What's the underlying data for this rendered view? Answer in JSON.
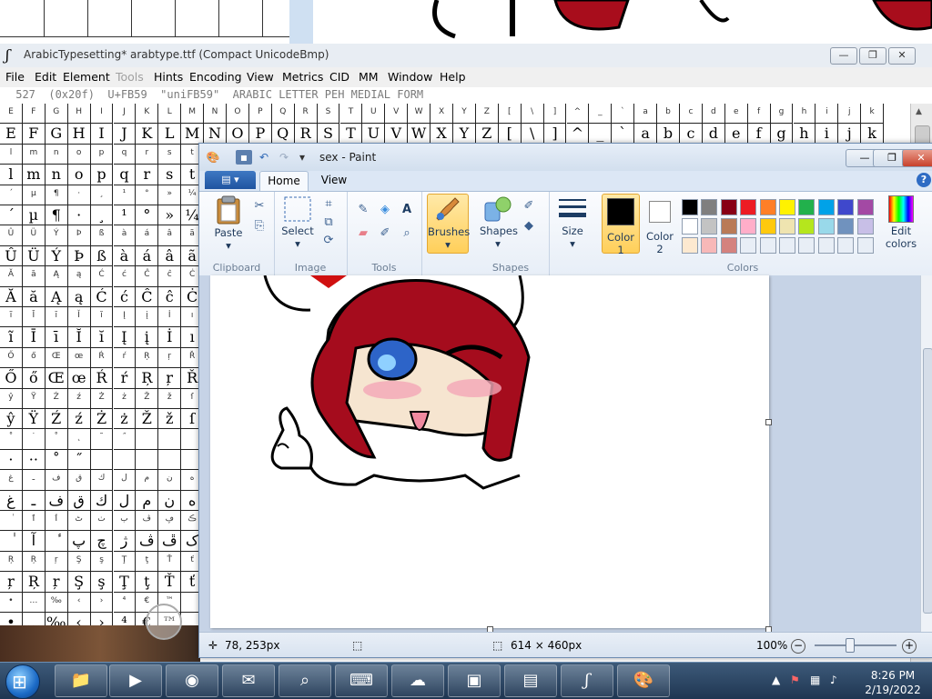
{
  "fontforge": {
    "title": "ArabicTypesetting*  arabtype.ttf (Compact UnicodeBmp)",
    "menu": [
      "File",
      "Edit",
      "Element",
      "Tools",
      "Hints",
      "Encoding",
      "View",
      "Metrics",
      "CID",
      "MM",
      "Window",
      "Help"
    ],
    "disabled_menu": "Tools",
    "info_line": " 527  (0x20f)  U+FB59  \"uniFB59\"  ARABIC LETTER PEH MEDIAL FORM",
    "header_row": [
      "E",
      "F",
      "G",
      "H",
      "I",
      "J",
      "K",
      "L",
      "M",
      "N",
      "O",
      "P",
      "Q",
      "R",
      "S",
      "T",
      "U",
      "V",
      "W",
      "X",
      "Y",
      "Z",
      "[",
      "\\",
      "]",
      "^",
      "_",
      "`",
      "a",
      "b",
      "c",
      "d",
      "e",
      "f",
      "g",
      "h",
      "i",
      "j",
      "k"
    ],
    "glyph_row": [
      "E",
      "F",
      "G",
      "H",
      "I",
      "J",
      "K",
      "L",
      "M",
      "N",
      "O",
      "P",
      "Q",
      "R",
      "S",
      "T",
      "U",
      "V",
      "W",
      "X",
      "Y",
      "Z",
      "[",
      "\\",
      "]",
      "^",
      "_",
      "`",
      "a",
      "b",
      "c",
      "d",
      "e",
      "f",
      "g",
      "h",
      "i",
      "j",
      "k"
    ],
    "left_grid": [
      [
        "l",
        "m",
        "n",
        "o",
        "p",
        "q",
        "r",
        "s",
        "t"
      ],
      [
        "l",
        "m",
        "n",
        "o",
        "p",
        "q",
        "r",
        "s",
        "t"
      ],
      [
        "´",
        "µ",
        "¶",
        "·",
        "¸",
        "¹",
        "°",
        "»",
        "¼"
      ],
      [
        "´",
        "µ",
        "¶",
        "·",
        "¸",
        "¹",
        "°",
        "»",
        "¼"
      ],
      [
        "Û",
        "Ü",
        "Ý",
        "Þ",
        "ß",
        "à",
        "á",
        "â",
        "ã"
      ],
      [
        "Û",
        "Ü",
        "Ý",
        "Þ",
        "ß",
        "à",
        "á",
        "â",
        "ã"
      ],
      [
        "Ă",
        "ă",
        "Ą",
        "ą",
        "Ć",
        "ć",
        "Ĉ",
        "ĉ",
        "Ċ"
      ],
      [
        "Ă",
        "ă",
        "Ą",
        "ą",
        "Ć",
        "ć",
        "Ĉ",
        "ĉ",
        "Ċ"
      ],
      [
        "ĩ",
        "Ī",
        "ī",
        "Ĭ",
        "ĭ",
        "Į",
        "į",
        "İ",
        "ı"
      ],
      [
        "ĩ",
        "Ī",
        "ī",
        "Ĭ",
        "ĭ",
        "Į",
        "į",
        "İ",
        "ı"
      ],
      [
        "Ő",
        "ő",
        "Œ",
        "œ",
        "Ŕ",
        "ŕ",
        "Ŗ",
        "ŗ",
        "Ř"
      ],
      [
        "Ő",
        "ő",
        "Œ",
        "œ",
        "Ŕ",
        "ŕ",
        "Ŗ",
        "ŗ",
        "Ř"
      ],
      [
        "ŷ",
        "Ÿ",
        "Ź",
        "ź",
        "Ż",
        "ż",
        "Ž",
        "ž",
        "ſ"
      ],
      [
        "ŷ",
        "Ÿ",
        "Ź",
        "ź",
        "Ż",
        "ż",
        "Ž",
        "ž",
        "ſ"
      ],
      [
        "˚",
        "˙",
        "˚",
        "˛",
        "˜",
        "˝",
        "",
        "",
        ""
      ],
      [
        "·",
        "··",
        "˚",
        "˝",
        "",
        "",
        "",
        "",
        ""
      ],
      [
        "غ",
        "ـ",
        "ف",
        "ق",
        "ك",
        "ل",
        "م",
        "ن",
        "ه"
      ],
      [
        "غ",
        "ـ",
        "ف",
        "ق",
        "ك",
        "ل",
        "م",
        "ن",
        "ه"
      ],
      [
        "ٰ",
        "ٱ",
        "ٲ",
        "ٹ",
        "ٺ",
        "ٻ",
        "ڤ",
        "ڥ",
        "ڪ"
      ],
      [
        "ٰ",
        "آ",
        "ٔ",
        "پ",
        "چ",
        "ژ",
        "ڤ",
        "ڦ",
        "ک"
      ],
      [
        "Ŗ",
        "Ŗ",
        "ŗ",
        "Ş",
        "ş",
        "Ţ",
        "ţ",
        "Ť",
        "ť"
      ],
      [
        "ŗ",
        "Ŗ",
        "ŗ",
        "Ş",
        "ş",
        "Ţ",
        "ţ",
        "Ť",
        "ť"
      ],
      [
        "•",
        "…",
        "‰",
        "‹",
        "›",
        "⁴",
        "€",
        "™",
        ""
      ],
      [
        "•",
        "…",
        "‰",
        "‹",
        "›",
        "⁴",
        "€",
        "™",
        ""
      ]
    ]
  },
  "paint": {
    "title": "sex - Paint",
    "tabs": [
      "Home",
      "View"
    ],
    "active_tab": "Home",
    "groups": {
      "clipboard": "Clipboard",
      "image": "Image",
      "tools": "Tools",
      "shapes": "Shapes",
      "colors": "Colors"
    },
    "buttons": {
      "paste": "Paste",
      "select": "Select",
      "brushes": "Brushes",
      "shapes": "Shapes",
      "size": "Size",
      "color1": "Color",
      "color1_num": "1",
      "color2": "Color",
      "color2_num": "2",
      "edit_colors_1": "Edit",
      "edit_colors_2": "colors"
    },
    "palette_row1": [
      "#000000",
      "#7f7f7f",
      "#880015",
      "#ed1c24",
      "#ff7f27",
      "#fff200",
      "#22b14c",
      "#00a2e8",
      "#3f48cc",
      "#a349a4"
    ],
    "palette_row2": [
      "#ffffff",
      "#c3c3c3",
      "#b97a57",
      "#ffaec9",
      "#ffc90e",
      "#efe4b0",
      "#b5e61d",
      "#99d9ea",
      "#7092be",
      "#c8bfe7"
    ],
    "palette_row3": [
      "#fde9d0",
      "#f7b8b8",
      "#d4827e",
      "#e8eef6",
      "#e8eef6",
      "#e8eef6",
      "#e8eef6",
      "#e8eef6",
      "#e8eef6",
      "#e8eef6"
    ],
    "color1_value": "#000000",
    "color2_value": "#ffffff",
    "status": {
      "cursor": "78, 253px",
      "size": "614 × 460px",
      "zoom": "100%"
    }
  },
  "taskbar": {
    "time": "8:26 PM",
    "date": "2/19/2022"
  }
}
